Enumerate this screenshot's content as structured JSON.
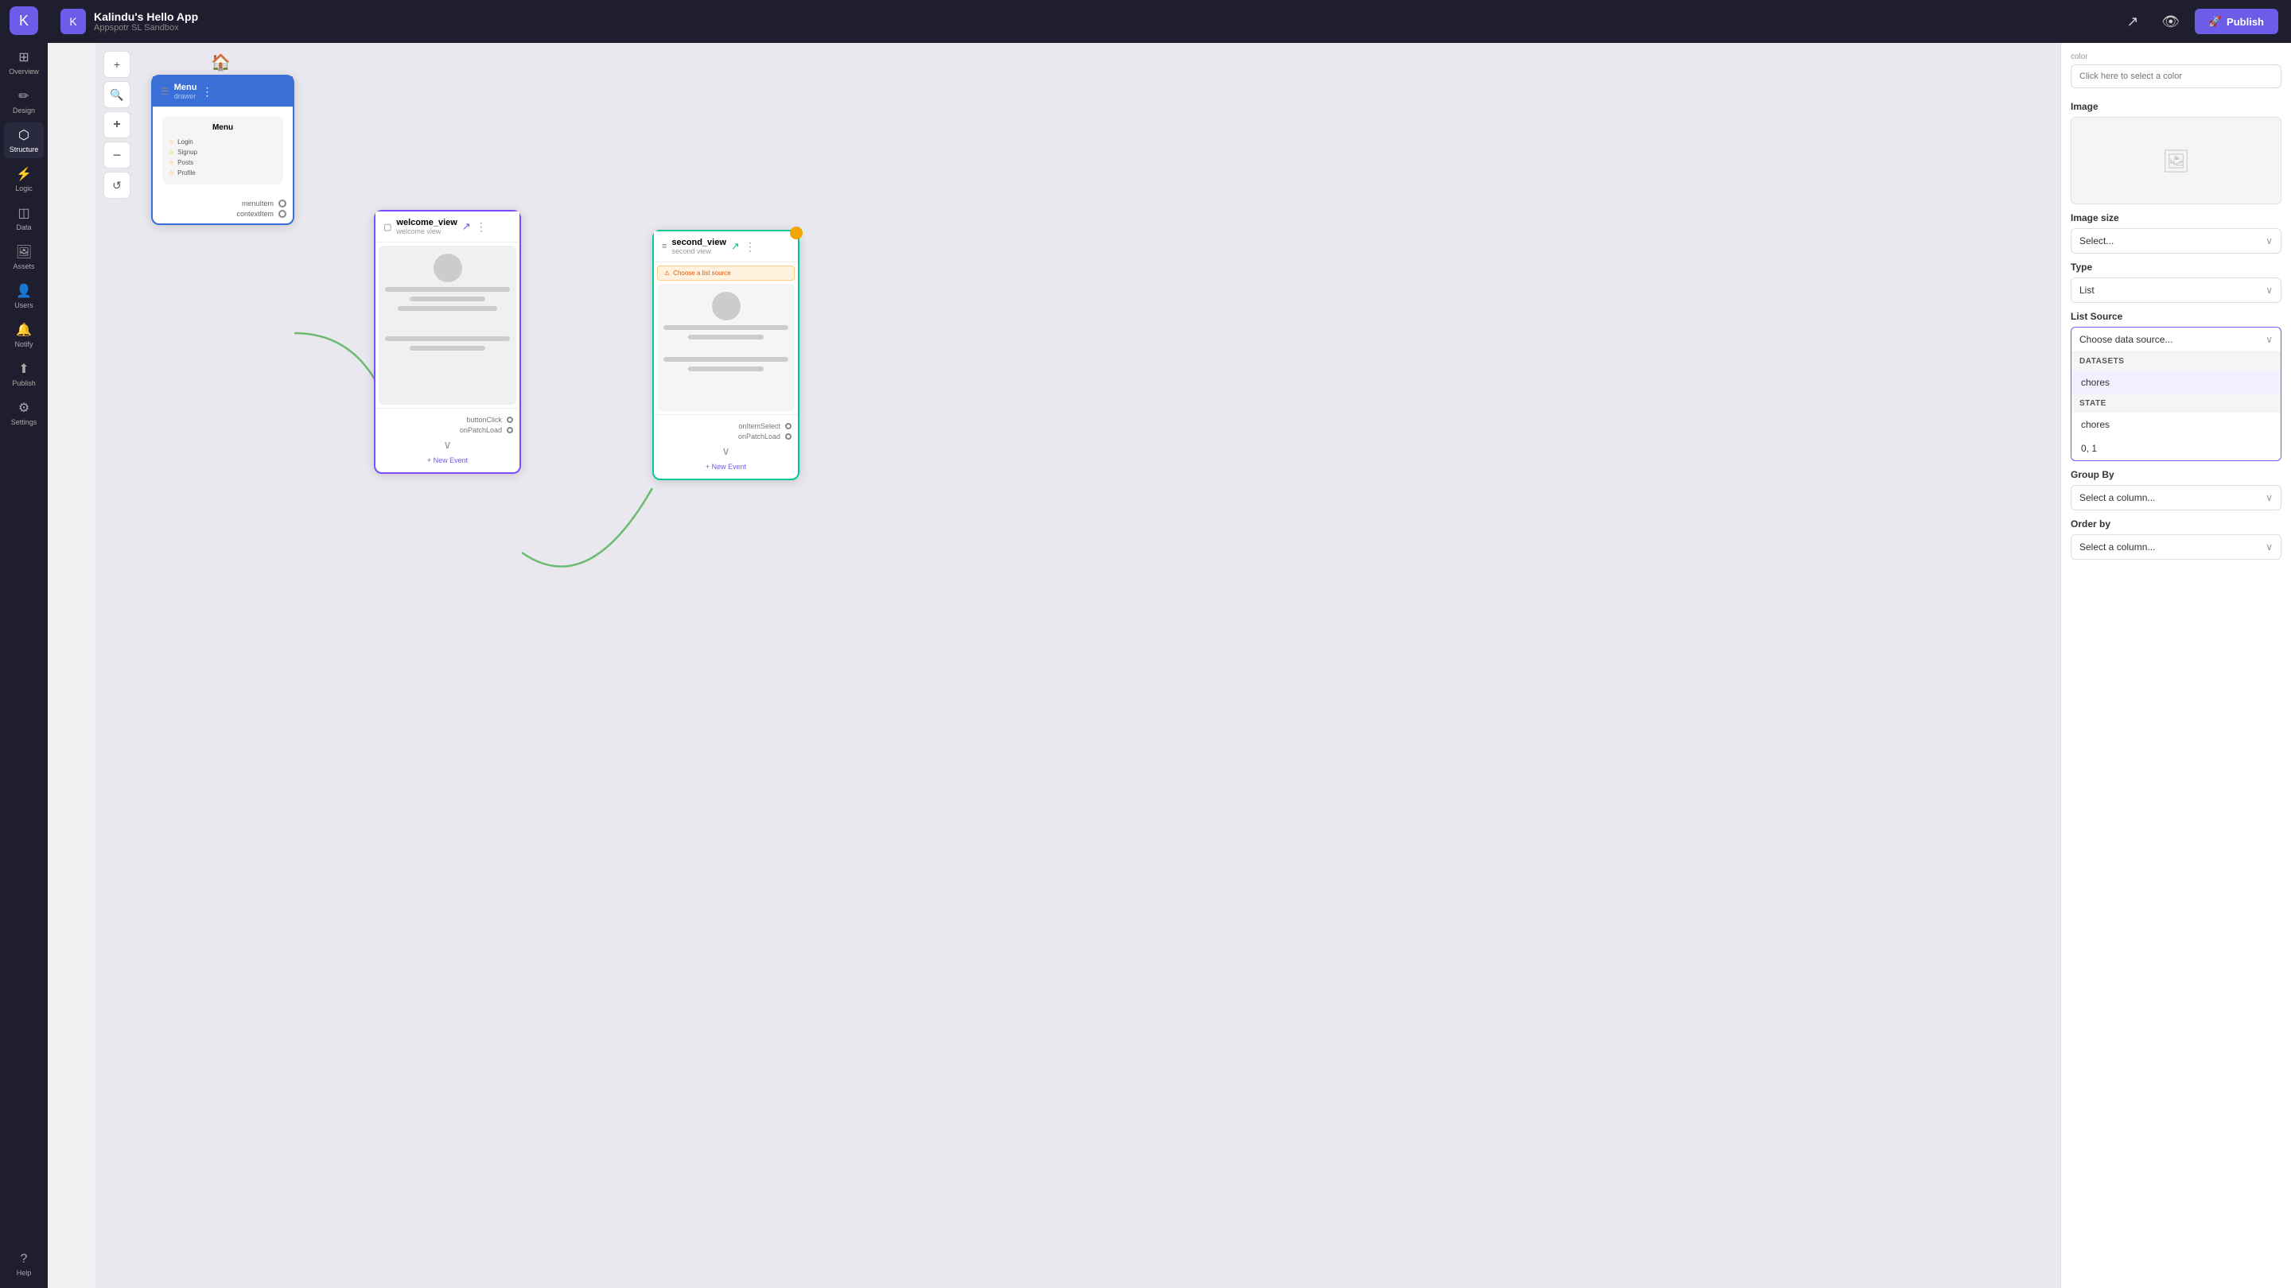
{
  "app": {
    "name": "Kalindu's Hello App",
    "sandbox": "Appspotr SL Sandbox",
    "logo_icon": "K"
  },
  "topbar": {
    "share_icon": "↗",
    "preview_icon": "👁",
    "publish_label": "Publish",
    "publish_icon": "🚀"
  },
  "sidebar": {
    "items": [
      {
        "id": "overview",
        "label": "Overview",
        "icon": "⊞"
      },
      {
        "id": "design",
        "label": "Design",
        "icon": "✏️"
      },
      {
        "id": "structure",
        "label": "Structure",
        "icon": "⬡",
        "active": true
      },
      {
        "id": "logic",
        "label": "Logic",
        "icon": "⚡"
      },
      {
        "id": "data",
        "label": "Data",
        "icon": "◫"
      },
      {
        "id": "assets",
        "label": "Assets",
        "icon": "🖼"
      },
      {
        "id": "users",
        "label": "Users",
        "icon": "👤"
      },
      {
        "id": "notify",
        "label": "Notify",
        "icon": "🔔"
      },
      {
        "id": "publish",
        "label": "Publish",
        "icon": "⬆"
      },
      {
        "id": "settings",
        "label": "Settings",
        "icon": "⚙"
      },
      {
        "id": "help",
        "label": "Help",
        "icon": "?"
      }
    ]
  },
  "mini_toolbar": {
    "add_icon": "+",
    "search_icon": "🔍",
    "zoom_in_icon": "+",
    "zoom_out_icon": "−",
    "refresh_icon": "↺"
  },
  "screens": {
    "menu": {
      "title": "Menu",
      "subtitle": "drawer",
      "type_icon": "☰",
      "menu_items": [
        "Login",
        "Signup",
        "Posts",
        "Profile"
      ],
      "connections": [
        {
          "label": "menuItem",
          "type": "output"
        },
        {
          "label": "contextItem",
          "type": "output"
        }
      ]
    },
    "welcome": {
      "title": "welcome_view",
      "subtitle": "welcome view",
      "type_icon": "▢",
      "events": [
        {
          "label": "buttonClick"
        },
        {
          "label": "onPatchLoad"
        }
      ],
      "new_event_label": "+ New Event"
    },
    "second": {
      "title": "second_view",
      "subtitle": "second view",
      "type_icon": "≡",
      "warning_text": "Choose a list source",
      "events": [
        {
          "label": "onItemSelect"
        },
        {
          "label": "onPatchLoad"
        }
      ],
      "new_event_label": "+ New Event"
    }
  },
  "right_panel": {
    "color_section_label": "Color",
    "color_placeholder": "Click here to select a color",
    "image_label": "Image",
    "image_size_label": "Image size",
    "image_size_placeholder": "Select...",
    "type_label": "Type",
    "type_value": "List",
    "list_source_label": "List Source",
    "list_source_placeholder": "Choose data source...",
    "datasets_header": "DATASETS",
    "dataset_item": "chores",
    "state_header": "STATE",
    "state_item": "chores",
    "partial_item": "0, 1",
    "group_by_label": "Group By",
    "group_by_placeholder": "Select a column...",
    "order_by_label": "Order by",
    "order_by_placeholder": "Select a column..."
  }
}
